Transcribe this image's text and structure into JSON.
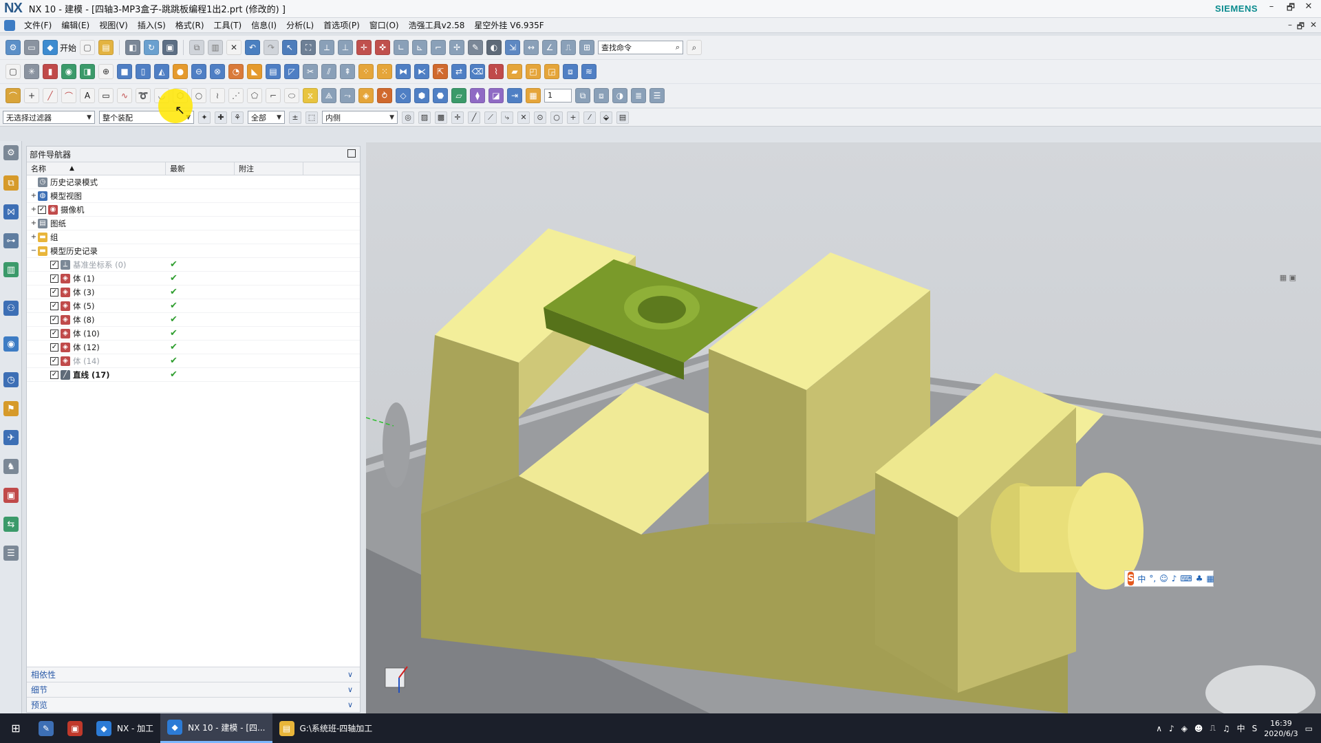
{
  "window": {
    "logo": "NX",
    "title": "NX 10 - 建模 - [四轴3-MP3盒子-跳跳板编程1出2.prt  (修改的)  ]",
    "brand": "SIEMENS",
    "controls": {
      "minimize": "–",
      "restore": "🗗",
      "close": "✕"
    }
  },
  "menubar": {
    "items": [
      "文件(F)",
      "编辑(E)",
      "视图(V)",
      "插入(S)",
      "格式(R)",
      "工具(T)",
      "信息(I)",
      "分析(L)",
      "首选项(P)",
      "窗口(O)",
      "浩强工具v2.58",
      "星空外挂 V6.935F"
    ]
  },
  "toolbar1": {
    "start_label": "开始",
    "search_placeholder": "查找命令"
  },
  "toolbar3": {
    "number_value": "1"
  },
  "selection_bar": {
    "filter_value": "无选择过滤器",
    "scope_value": "整个装配",
    "type_value": "全部",
    "rule_value": "内侧"
  },
  "navigator": {
    "title": "部件导航器",
    "columns": [
      "名称",
      "最新",
      "附注"
    ],
    "sort_indicator": "▲",
    "rows": [
      {
        "label": "历史记录模式",
        "indent": 0,
        "expander": "",
        "checked": "",
        "icon": "clock-icon",
        "latest": "",
        "greyed": false,
        "bold": false
      },
      {
        "label": "模型视图",
        "indent": 0,
        "expander": "+",
        "checked": "",
        "icon": "views-icon",
        "latest": "",
        "greyed": false,
        "bold": false
      },
      {
        "label": "摄像机",
        "indent": 0,
        "expander": "+",
        "checked": "✓",
        "icon": "camera-icon",
        "latest": "",
        "greyed": false,
        "bold": false
      },
      {
        "label": "图纸",
        "indent": 0,
        "expander": "+",
        "checked": "",
        "icon": "drawing-icon",
        "latest": "",
        "greyed": false,
        "bold": false
      },
      {
        "label": "组",
        "indent": 0,
        "expander": "+",
        "checked": "",
        "icon": "folder-icon",
        "latest": "",
        "greyed": false,
        "bold": false
      },
      {
        "label": "模型历史记录",
        "indent": 0,
        "expander": "−",
        "checked": "",
        "icon": "folder-icon",
        "latest": "",
        "greyed": false,
        "bold": false
      },
      {
        "label": "基准坐标系 (0)",
        "indent": 1,
        "expander": "",
        "checked": "✓",
        "icon": "csys-icon",
        "latest": "✔",
        "greyed": true,
        "bold": false
      },
      {
        "label": "体 (1)",
        "indent": 1,
        "expander": "",
        "checked": "✓",
        "icon": "body-icon",
        "latest": "✔",
        "greyed": false,
        "bold": false
      },
      {
        "label": "体 (3)",
        "indent": 1,
        "expander": "",
        "checked": "✓",
        "icon": "body-icon",
        "latest": "✔",
        "greyed": false,
        "bold": false
      },
      {
        "label": "体 (5)",
        "indent": 1,
        "expander": "",
        "checked": "✓",
        "icon": "body-icon",
        "latest": "✔",
        "greyed": false,
        "bold": false
      },
      {
        "label": "体 (8)",
        "indent": 1,
        "expander": "",
        "checked": "✓",
        "icon": "body-icon",
        "latest": "✔",
        "greyed": false,
        "bold": false
      },
      {
        "label": "体 (10)",
        "indent": 1,
        "expander": "",
        "checked": "✓",
        "icon": "body-icon",
        "latest": "✔",
        "greyed": false,
        "bold": false
      },
      {
        "label": "体 (12)",
        "indent": 1,
        "expander": "",
        "checked": "✓",
        "icon": "body-icon",
        "latest": "✔",
        "greyed": false,
        "bold": false
      },
      {
        "label": "体 (14)",
        "indent": 1,
        "expander": "",
        "checked": "✓",
        "icon": "body-icon",
        "latest": "✔",
        "greyed": true,
        "bold": false
      },
      {
        "label": "直线 (17)",
        "indent": 1,
        "expander": "",
        "checked": "✓",
        "icon": "line-icon",
        "latest": "✔",
        "greyed": false,
        "bold": true
      }
    ],
    "sections": [
      "相依性",
      "细节",
      "预览"
    ]
  },
  "ime": {
    "logo": "S",
    "mode": "中",
    "punct": "°,"
  },
  "taskbar": {
    "tasks": [
      {
        "label": "NX - 加工",
        "active": false
      },
      {
        "label": "NX 10 - 建模 - [四...",
        "active": true
      },
      {
        "label": "G:\\系统班-四轴加工",
        "active": false
      }
    ],
    "ime_indicator": "中",
    "time": "16:39",
    "date": "2020/6/3"
  },
  "colors": {
    "part_yellow": "#f0e68c",
    "part_green": "#6b8e23",
    "check_green": "#2f9e2f",
    "section_blue": "#2a5aa8"
  }
}
